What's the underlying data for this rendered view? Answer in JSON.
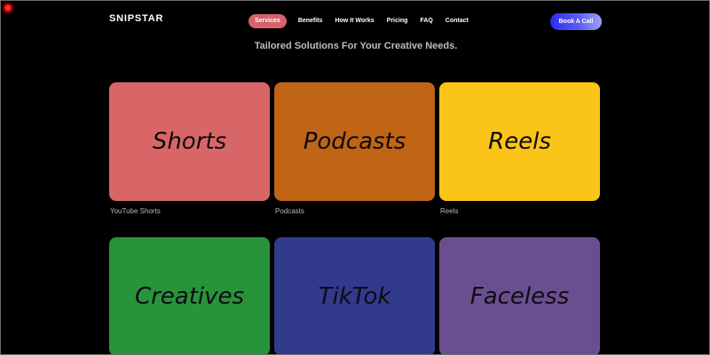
{
  "brand": {
    "logo_text": "SNIPSTAR"
  },
  "nav": {
    "items": [
      {
        "label": "Services",
        "active": true
      },
      {
        "label": "Benefits"
      },
      {
        "label": "How It Works"
      },
      {
        "label": "Pricing"
      },
      {
        "label": "FAQ"
      },
      {
        "label": "Contact"
      }
    ],
    "cta_label": "Book A Call"
  },
  "hero": {
    "tagline": "Tailored Solutions For Your Creative Needs."
  },
  "services": [
    {
      "title": "Shorts",
      "caption": "YouTube Shorts",
      "color": "#d96666"
    },
    {
      "title": "Podcasts",
      "caption": "Podcasts",
      "color": "#c06515"
    },
    {
      "title": "Reels",
      "caption": "Reels",
      "color": "#fbc418"
    },
    {
      "title": "Creatives",
      "caption": "",
      "color": "#27943a"
    },
    {
      "title": "TikTok",
      "caption": "",
      "color": "#313a8b"
    },
    {
      "title": "Faceless",
      "caption": "",
      "color": "#6a4f90"
    }
  ]
}
